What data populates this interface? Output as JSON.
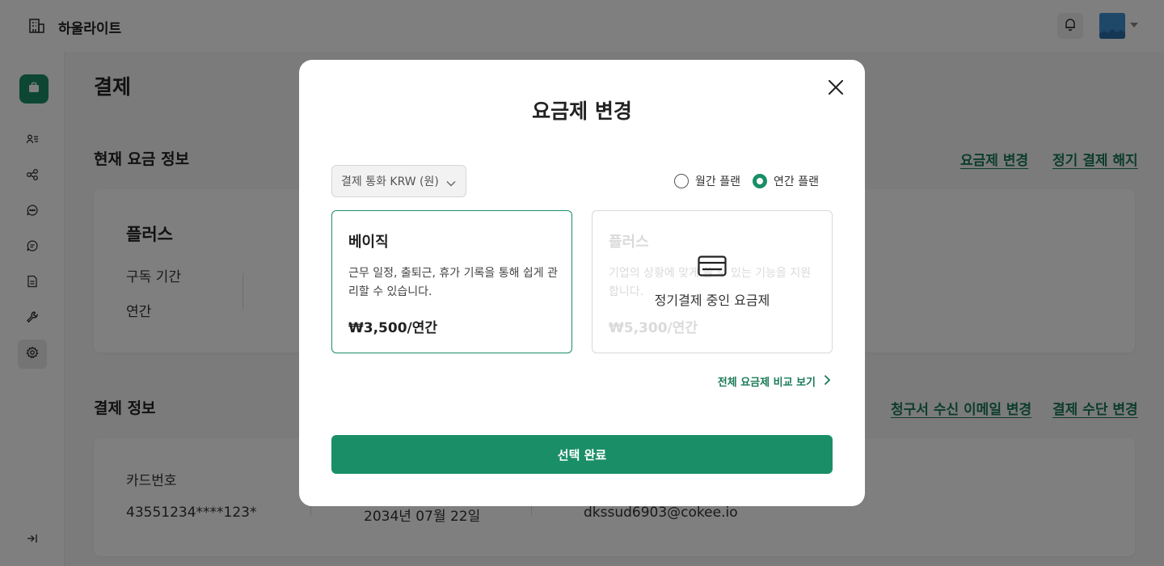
{
  "app": {
    "name": "하울라이트"
  },
  "colors": {
    "accent": "#1a8f67",
    "link": "#1a7a57",
    "avatar": "#3d8fd1"
  },
  "header": {
    "bell_icon": "bell-icon",
    "avatar_icon": "avatar-image"
  },
  "sidebar": {
    "items": [
      {
        "icon": "briefcase-icon"
      },
      {
        "icon": "user-list-icon"
      },
      {
        "icon": "org-chart-icon"
      },
      {
        "icon": "chat-icon"
      },
      {
        "icon": "chat-bubble-icon"
      },
      {
        "icon": "document-icon"
      },
      {
        "icon": "wrench-icon"
      },
      {
        "icon": "gear-icon",
        "active": true
      }
    ],
    "collapse_icon": "collapse-arrow-icon"
  },
  "page": {
    "title": "결제",
    "current_plan": {
      "title": "현재 요금 정보",
      "change_plan_link": "요금제 변경",
      "cancel_link": "정기 결제 해지",
      "plan_name": "플러스",
      "period_label": "구독 기간",
      "period_value": "연간"
    },
    "billing": {
      "title": "결제 정보",
      "change_email_link": "청구서 수신 이메일 변경",
      "change_method_link": "결제 수단 변경",
      "card_label": "카드번호",
      "card_number": "43551234****123*",
      "date": "2034년 07월 22일",
      "email": "dkssud6903@cokee.io"
    }
  },
  "modal": {
    "title": "요금제 변경",
    "currency_select": "결제 통화 KRW (원)",
    "billing_cycle": {
      "monthly_label": "월간 플랜",
      "yearly_label": "연간 플랜",
      "selected": "yearly"
    },
    "plans": [
      {
        "name": "베이직",
        "description": "근무 일정, 출퇴근, 휴가 기록을 통해 쉽게 관리할 수 있습니다.",
        "price": "₩3,500/연간",
        "selected": true
      },
      {
        "name": "플러스",
        "description": "기업의 상황에 맞게 쓸 수 있는 기능을 지원합니다.",
        "price": "₩5,300/연간",
        "disabled": true,
        "overlay_text": "정기결제 중인 요금제",
        "overlay_icon": "credit-card-icon"
      }
    ],
    "compare_link": "전체 요금제 비교 보기",
    "confirm_button": "선택 완료"
  }
}
